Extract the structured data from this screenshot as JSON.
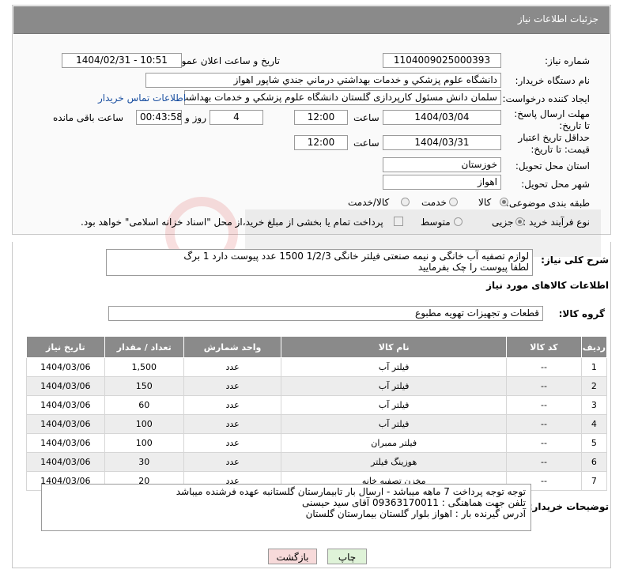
{
  "header": {
    "title": "جزئیات اطلاعات نیاز"
  },
  "form": {
    "need_number_label": "شماره نیاز:",
    "need_number": "1104009025000393",
    "announce_label": "تاریخ و ساعت اعلان عمومی:",
    "announce_value": "1404/02/31 - 10:51",
    "buyer_org_label": "نام دستگاه خریدار:",
    "buyer_org": "دانشگاه علوم پزشکي و خدمات بهداشتي درماني جندي شاپور اهواز",
    "creator_label": "ایجاد کننده درخواست:",
    "creator": "سلمان دانش مسئول کارپردازی گلستان دانشگاه علوم پزشکي و خدمات بهداشت",
    "contact_link": "اطلاعات تماس خریدار",
    "reply_deadline_label": "مهلت ارسال پاسخ: تا تاریخ:",
    "reply_date": "1404/03/04",
    "time_label": "ساعت",
    "reply_time": "12:00",
    "day_label": "روز و",
    "days": "4",
    "remaining_time": "00:43:58",
    "remaining_label": "ساعت باقی مانده",
    "price_deadline_label": "حداقل تاریخ اعتبار قیمت: تا تاریخ:",
    "price_date": "1404/03/31",
    "price_time": "12:00",
    "province_label": "استان محل تحویل:",
    "province": "خوزستان",
    "city_label": "شهر محل تحویل:",
    "city": "اهواز",
    "category_label": "طبقه بندی موضوعی:",
    "cat_goods": "کالا",
    "cat_service": "خدمت",
    "cat_goods_service": "کالا/خدمت",
    "process_label": "نوع فرآیند خرید :",
    "proc_partial": "جزیی",
    "proc_medium": "متوسط",
    "payment_note": "پرداخت تمام یا بخشی از مبلغ خرید،از محل \"اسناد خزانه اسلامی\" خواهد بود."
  },
  "summary": {
    "label": "شرح کلی نیاز:",
    "line1": "لوازم تصفیه آب خانگی و نیمه صنعتی  فیلتر خانگی 1/2/3 1500 عدد پیوست دارد 1 برگ",
    "line2": "لطفا پیوست را چک بفرمایید"
  },
  "items_section": {
    "title": "اطلاعات کالاهای مورد نیاز",
    "group_label": "گروه کالا:",
    "group_value": "قطعات و تجهیزات تهویه مطبوع"
  },
  "table": {
    "headers": [
      "ردیف",
      "کد کالا",
      "نام کالا",
      "واحد شمارش",
      "تعداد / مقدار",
      "تاریخ نیاز"
    ],
    "rows": [
      [
        "1",
        "--",
        "فیلتر آب",
        "عدد",
        "1,500",
        "1404/03/06"
      ],
      [
        "2",
        "--",
        "فیلتر آب",
        "عدد",
        "150",
        "1404/03/06"
      ],
      [
        "3",
        "--",
        "فیلتر آب",
        "عدد",
        "60",
        "1404/03/06"
      ],
      [
        "4",
        "--",
        "فیلتر آب",
        "عدد",
        "100",
        "1404/03/06"
      ],
      [
        "5",
        "--",
        "فیلتر ممبران",
        "عدد",
        "100",
        "1404/03/06"
      ],
      [
        "6",
        "--",
        "هوزینگ فیلتر",
        "عدد",
        "30",
        "1404/03/06"
      ],
      [
        "7",
        "--",
        "مخزن تصفیه خانه",
        "عدد",
        "20",
        "1404/03/06"
      ]
    ]
  },
  "buyer_notes": {
    "label": "توضیحات خریدار:",
    "line1": "توجه توجه پرداخت 7 ماهه میباشد - ارسال بار تابیمارستان گلستانبه عهده فرشنده میباشد",
    "line2": "تلفن جهت هماهنگی : 09363170011  آقای سید حیسنی",
    "line3": "آدرس گیرنده بار : اهواز بلوار گلستان بیمارستان گلستان"
  },
  "buttons": {
    "print": "چاپ",
    "back": "بازگشت"
  },
  "colors": {
    "header_bg": "#8a8a8a",
    "link": "#1a4fa0",
    "back_btn": "#f7dada",
    "print_btn": "#dff3d8"
  }
}
